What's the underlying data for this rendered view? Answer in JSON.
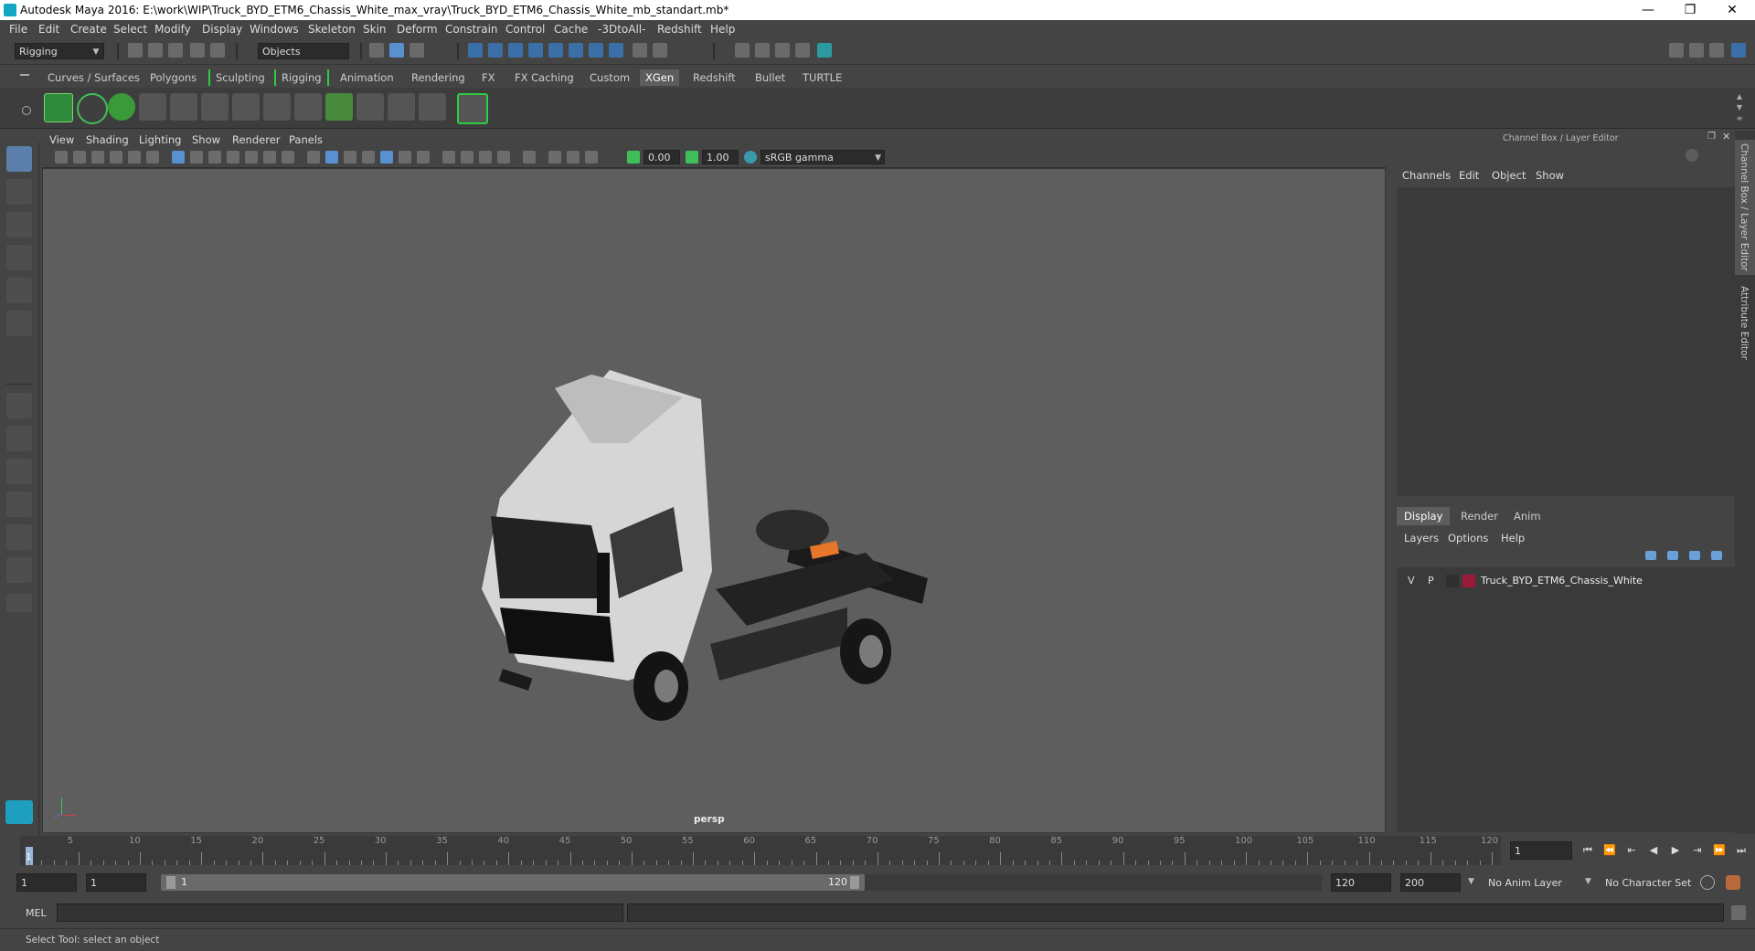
{
  "titlebar": {
    "title": "Autodesk Maya 2016: E:\\work\\WIP\\Truck_BYD_ETM6_Chassis_White_max_vray\\Truck_BYD_ETM6_Chassis_White_mb_standart.mb*",
    "minimize": "—",
    "restore": "❐",
    "close": "✕"
  },
  "menubar": [
    "File",
    "Edit",
    "Create",
    "Select",
    "Modify",
    "Display",
    "Windows",
    "Skeleton",
    "Skin",
    "Deform",
    "Constrain",
    "Control",
    "Cache",
    "-3DtoAll-",
    "Redshift",
    "Help"
  ],
  "statusline": {
    "menuset": "Rigging",
    "selection_mode": "Objects"
  },
  "shelf": {
    "tabs": [
      "Curves / Surfaces",
      "Polygons",
      "Sculpting",
      "Rigging",
      "Animation",
      "Rendering",
      "FX",
      "FX Caching",
      "Custom",
      "XGen",
      "Redshift",
      "Bullet",
      "TURTLE"
    ],
    "active_tab": "XGen"
  },
  "viewport": {
    "menus": [
      "View",
      "Shading",
      "Lighting",
      "Show",
      "Renderer",
      "Panels"
    ],
    "exposure": "0.00",
    "gamma": "1.00",
    "colorspace": "sRGB gamma",
    "camera_label": "persp"
  },
  "channelbox": {
    "title": "Channel Box / Layer Editor",
    "menus": [
      "Channels",
      "Edit",
      "Object",
      "Show"
    ]
  },
  "layereditor": {
    "tabs": [
      "Display",
      "Render",
      "Anim"
    ],
    "active_tab": "Display",
    "menus": [
      "Layers",
      "Options",
      "Help"
    ],
    "layers": [
      {
        "visible": "V",
        "playback": "P",
        "name": "Truck_BYD_ETM6_Chassis_White",
        "color": "#9b1a3a"
      }
    ]
  },
  "sidebar_tabs": [
    "Channel Box / Layer Editor",
    "Attribute Editor"
  ],
  "timeslider": {
    "ticks": [
      "5",
      "10",
      "15",
      "20",
      "25",
      "30",
      "35",
      "40",
      "45",
      "50",
      "55",
      "60",
      "65",
      "70",
      "75",
      "80",
      "85",
      "90",
      "95",
      "100",
      "105",
      "110",
      "115",
      "120"
    ],
    "start": "1",
    "current_frame": "1"
  },
  "rangeslider": {
    "start": "1",
    "playback_start": "1",
    "range_start_label": "1",
    "range_end_label": "120",
    "playback_end": "120",
    "end": "200",
    "anim_layer": "No Anim Layer",
    "character_set": "No Character Set"
  },
  "cmdline": {
    "label": "MEL"
  },
  "helpline": {
    "text": "Select Tool: select an object"
  }
}
